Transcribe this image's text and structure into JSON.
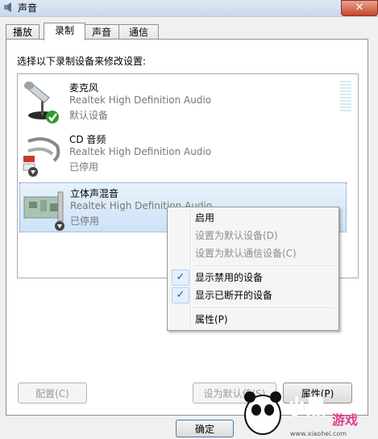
{
  "window": {
    "title": "声音",
    "close_glyph": "✕"
  },
  "tabs": [
    {
      "label": "播放",
      "active": false
    },
    {
      "label": "录制",
      "active": true
    },
    {
      "label": "声音",
      "active": false
    },
    {
      "label": "通信",
      "active": false
    }
  ],
  "instruction": "选择以下录制设备来修改设置:",
  "devices": [
    {
      "name": "麦克风",
      "description": "Realtek High Definition Audio",
      "status": "默认设备",
      "icon": "microphone-icon",
      "badge": "default-check-icon"
    },
    {
      "name": "CD 音频",
      "description": "Realtek High Definition Audio",
      "status": "已停用",
      "icon": "rca-cable-icon",
      "badge": "disabled-arrow-icon"
    },
    {
      "name": "立体声混音",
      "description": "Realtek High Definition Audio",
      "status": "已停用",
      "icon": "sound-card-icon",
      "badge": "disabled-arrow-icon",
      "selected": true
    }
  ],
  "buttons": {
    "configure": "配置(C)",
    "set_default": "设为默认值(S)",
    "properties": "属性(P)",
    "ok": "确定"
  },
  "context_menu": {
    "items": [
      {
        "label": "启用",
        "enabled": true,
        "checked": false
      },
      {
        "label": "设置为默认设备(D)",
        "enabled": false,
        "checked": false
      },
      {
        "label": "设置为默认通信设备(C)",
        "enabled": false,
        "checked": false
      },
      {
        "label": "显示禁用的设备",
        "enabled": true,
        "checked": true
      },
      {
        "label": "显示已断开的设备",
        "enabled": true,
        "checked": true
      },
      {
        "label": "属性(P)",
        "enabled": true,
        "checked": false
      }
    ],
    "check_glyph": "✓"
  },
  "watermark": {
    "text": "小黑游戏",
    "url": "www.xiaohei.com"
  },
  "colors": {
    "selection": "#cde2f8",
    "check_green": "#2e9b2e",
    "accent": "#3c7fb1"
  }
}
